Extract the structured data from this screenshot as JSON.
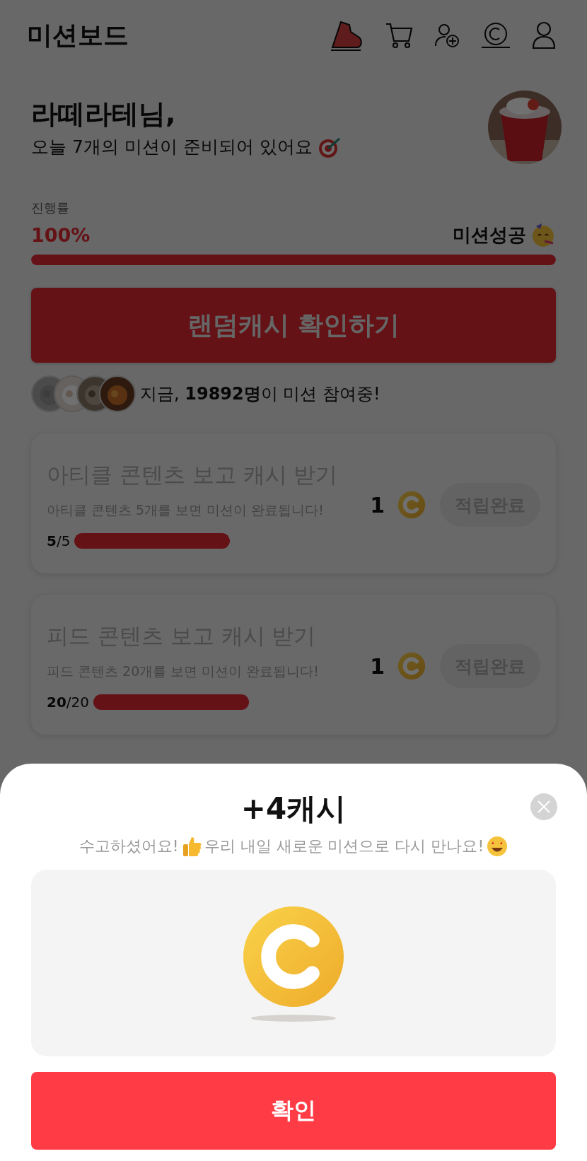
{
  "header": {
    "title": "미션보드"
  },
  "greeting": {
    "name": "라떼라테님,",
    "message": "오늘 7개의 미션이 준비되어 있어요"
  },
  "progress": {
    "label": "진행률",
    "percent": "100%",
    "level": 1,
    "status": "미션성공"
  },
  "random_cash_button": "랜덤캐시 확인하기",
  "participants": {
    "text": "지금, **19892명**이 미션 참여중!"
  },
  "missions": [
    {
      "title": "아티클 콘텐츠 보고 캐시 받기",
      "description": "아티클 콘텐츠 5개를 보면 미션이 완료됩니다!",
      "count": "**5**/5",
      "level": 1,
      "reward": "1",
      "button": "적립완료",
      "completed": true
    },
    {
      "title": "피드 콘텐츠 보고 캐시 받기",
      "description": "피드 콘텐츠 20개를 보면 미션이 완료됩니다!",
      "count": "**20**/20",
      "level": 1,
      "reward": "1",
      "button": "적립완료",
      "completed": true
    }
  ],
  "reward_sheet": {
    "title": "+4캐시",
    "message": [
      "수고하셨어요!",
      "우리 내일 새로운 미션으로 다시 만나요!"
    ],
    "confirm_button": "확인"
  }
}
